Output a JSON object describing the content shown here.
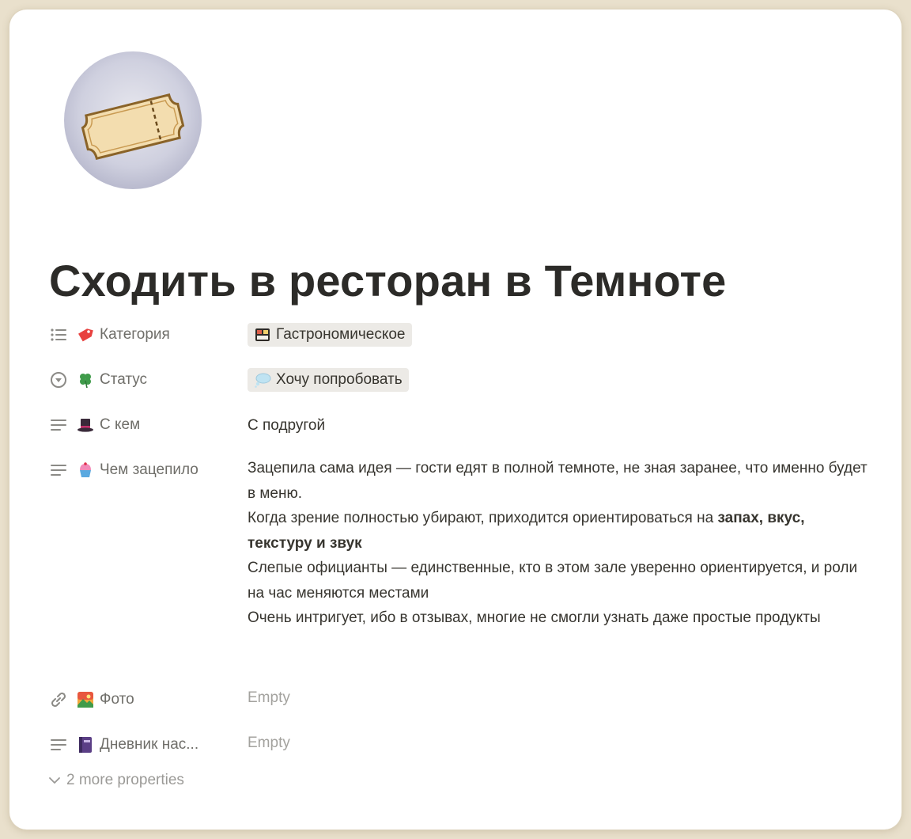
{
  "page": {
    "title": "Сходить в ресторан в Темноте",
    "icon": "ticket-icon"
  },
  "properties": [
    {
      "key": "Категория",
      "type_icon": "list-icon",
      "emoji": "tag-emoji-icon",
      "value_kind": "tag",
      "tag_emoji": "bento-emoji-icon",
      "value": "Гастрономическое"
    },
    {
      "key": "Статус",
      "type_icon": "status-icon",
      "emoji": "clover-emoji-icon",
      "value_kind": "tag",
      "tag_emoji": "thought-bubble-emoji-icon",
      "value": "Хочу попробовать"
    },
    {
      "key": "С кем",
      "type_icon": "text-icon",
      "emoji": "top-hat-emoji-icon",
      "value_kind": "text",
      "value": "С подругой"
    },
    {
      "key": "Чем зацепило",
      "type_icon": "text-icon",
      "emoji": "cupcake-emoji-icon",
      "value_kind": "rich",
      "paragraphs": [
        {
          "text": "Зацепила сама идея — гости едят в полной темноте, не зная заранее, что именно будет в меню."
        },
        {
          "text_before": "Когда зрение полностью убирают, приходится ориентироваться на ",
          "bold": "запах, вкус, текстуру и звук"
        },
        {
          "text": "Слепые официанты — единственные, кто в этом зале уверенно ориентируется, и роли на час меняются местами"
        },
        {
          "text": "Очень интригует, ибо в  отзывах, многие не смогли узнать даже простые продукты"
        }
      ]
    },
    {
      "key": "Фото",
      "type_icon": "link-icon",
      "emoji": "picture-emoji-icon",
      "value_kind": "empty",
      "value": "Empty"
    },
    {
      "key": "Дневник нас...",
      "type_icon": "text-icon",
      "emoji": "notebook-emoji-icon",
      "value_kind": "empty",
      "value": "Empty"
    }
  ],
  "more_properties": {
    "label": "2 more properties",
    "icon": "chevron-down-icon"
  },
  "colors": {
    "background": "#e9e0cc",
    "card": "#ffffff",
    "tag_bg": "#eceae6",
    "muted_text": "#a3a29e",
    "key_text": "#6f6e69"
  }
}
